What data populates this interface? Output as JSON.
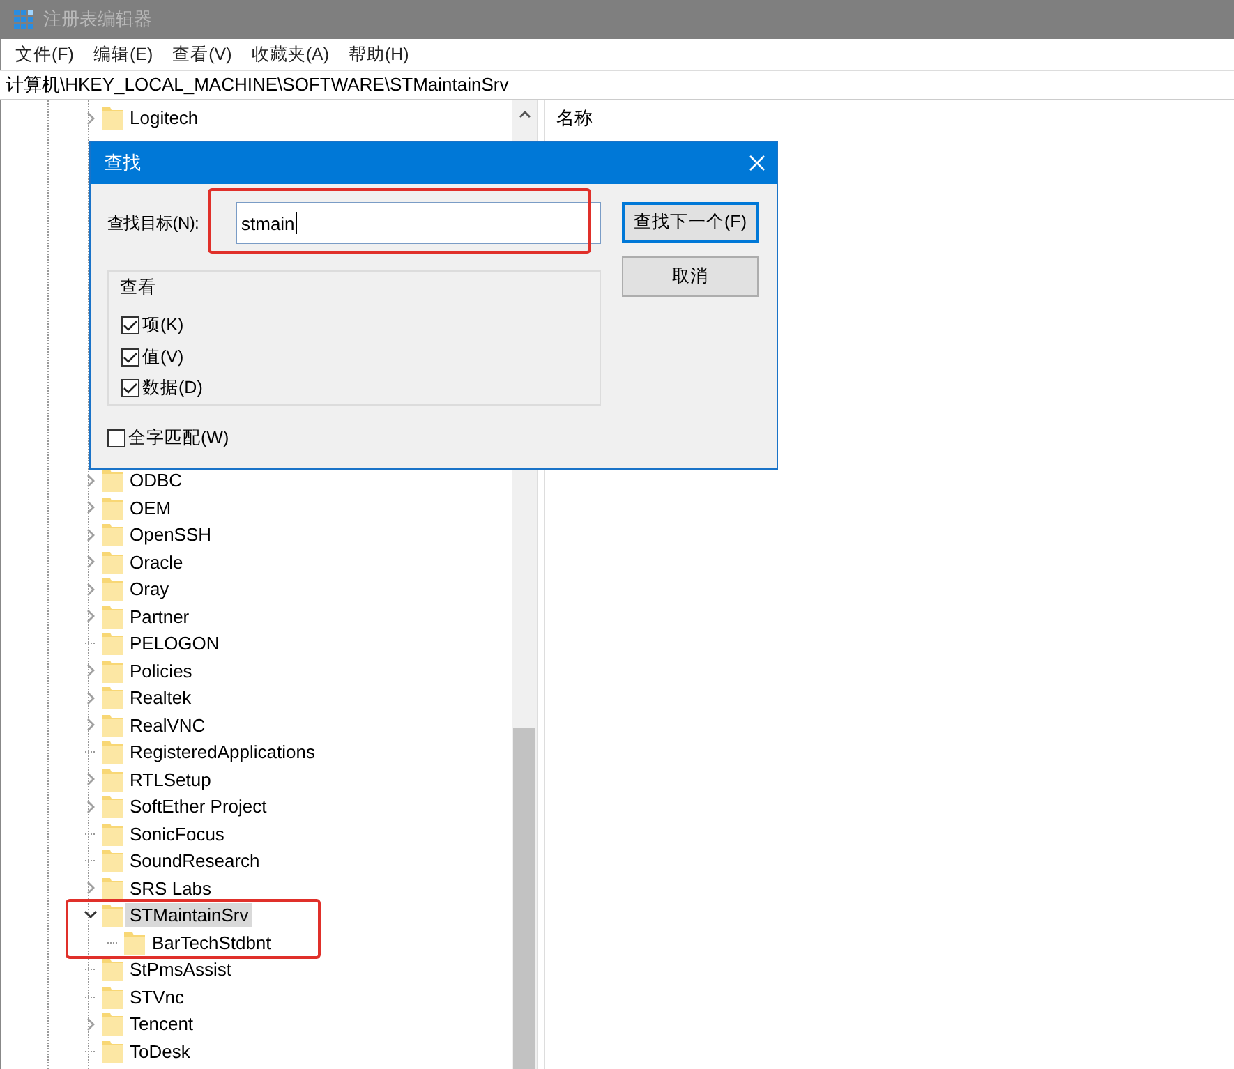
{
  "window": {
    "title": "注册表编辑器",
    "active": false
  },
  "menu": [
    "文件(F)",
    "编辑(E)",
    "查看(V)",
    "收藏夹(A)",
    "帮助(H)"
  ],
  "address": "计算机\\HKEY_LOCAL_MACHINE\\SOFTWARE\\STMaintainSrv",
  "tree": {
    "items_above_dialog": [
      {
        "label": "Logitech",
        "expandable": true,
        "expanded": false,
        "selected": false
      }
    ],
    "items_below_dialog": [
      {
        "label": "ODBC",
        "expandable": true,
        "expanded": false,
        "selected": false
      },
      {
        "label": "OEM",
        "expandable": true,
        "expanded": false,
        "selected": false
      },
      {
        "label": "OpenSSH",
        "expandable": true,
        "expanded": false,
        "selected": false
      },
      {
        "label": "Oracle",
        "expandable": true,
        "expanded": false,
        "selected": false
      },
      {
        "label": "Oray",
        "expandable": true,
        "expanded": false,
        "selected": false
      },
      {
        "label": "Partner",
        "expandable": true,
        "expanded": false,
        "selected": false
      },
      {
        "label": "PELOGON",
        "expandable": false,
        "selected": false
      },
      {
        "label": "Policies",
        "expandable": true,
        "expanded": false,
        "selected": false
      },
      {
        "label": "Realtek",
        "expandable": true,
        "expanded": false,
        "selected": false
      },
      {
        "label": "RealVNC",
        "expandable": true,
        "expanded": false,
        "selected": false
      },
      {
        "label": "RegisteredApplications",
        "expandable": false,
        "selected": false
      },
      {
        "label": "RTLSetup",
        "expandable": true,
        "expanded": false,
        "selected": false
      },
      {
        "label": "SoftEther Project",
        "expandable": true,
        "expanded": false,
        "selected": false
      },
      {
        "label": "SonicFocus",
        "expandable": false,
        "selected": false
      },
      {
        "label": "SoundResearch",
        "expandable": false,
        "selected": false
      },
      {
        "label": "SRS Labs",
        "expandable": true,
        "expanded": false,
        "selected": false
      },
      {
        "label": "STMaintainSrv",
        "expandable": true,
        "expanded": true,
        "selected": true,
        "highlighted": true,
        "children": [
          {
            "label": "BarTechStdbnt",
            "expandable": false,
            "selected": false
          }
        ]
      },
      {
        "label": "StPmsAssist",
        "expandable": false,
        "selected": false
      },
      {
        "label": "STVnc",
        "expandable": false,
        "selected": false
      },
      {
        "label": "Tencent",
        "expandable": true,
        "expanded": false,
        "selected": false
      },
      {
        "label": "ToDesk",
        "expandable": false,
        "selected": false
      }
    ]
  },
  "list": {
    "columns": [
      "名称"
    ]
  },
  "dialog": {
    "title": "查找",
    "find_label": "查找目标(N):",
    "find_value": "stmain",
    "find_highlighted": true,
    "look_in": {
      "title": "查看",
      "options": [
        {
          "label": "项(K)",
          "checked": true
        },
        {
          "label": "值(V)",
          "checked": true
        },
        {
          "label": "数据(D)",
          "checked": true
        }
      ]
    },
    "match_whole": {
      "label": "全字匹配(W)",
      "checked": false
    },
    "buttons": [
      {
        "label": "查找下一个(F)",
        "default": true
      },
      {
        "label": "取消",
        "default": false
      }
    ]
  }
}
